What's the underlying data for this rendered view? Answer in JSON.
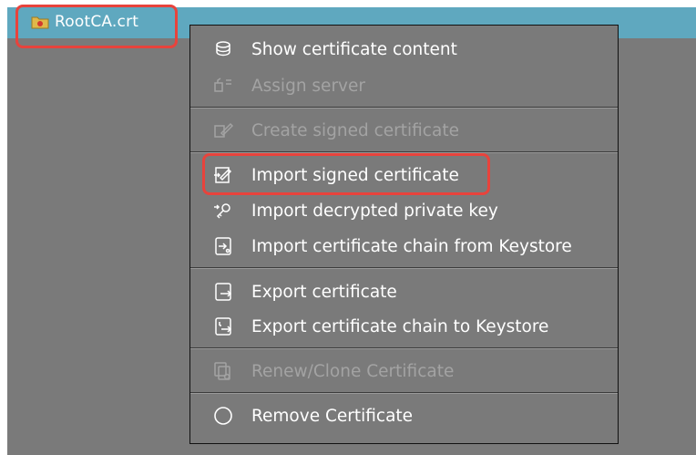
{
  "tree": {
    "node_label": "RootCA.crt",
    "node_icon": "certificate-folder-icon"
  },
  "menu": {
    "items": [
      {
        "label": "Show certificate content",
        "icon": "certificate-content-icon",
        "enabled": true
      },
      {
        "label": "Assign server",
        "icon": "assign-server-icon",
        "enabled": false
      },
      {
        "label": "Create signed certificate",
        "icon": "create-signed-certificate-icon",
        "enabled": false
      },
      {
        "label": "Import signed certificate",
        "icon": "import-signed-certificate-icon",
        "enabled": true
      },
      {
        "label": "Import decrypted private key",
        "icon": "import-private-key-icon",
        "enabled": true
      },
      {
        "label": "Import certificate chain from Keystore",
        "icon": "import-chain-icon",
        "enabled": true
      },
      {
        "label": "Export certificate",
        "icon": "export-certificate-icon",
        "enabled": true
      },
      {
        "label": "Export certificate chain to Keystore",
        "icon": "export-chain-icon",
        "enabled": true
      },
      {
        "label": "Renew/Clone Certificate",
        "icon": "renew-clone-icon",
        "enabled": false
      },
      {
        "label": "Remove Certificate",
        "icon": "remove-circle-icon",
        "enabled": true
      }
    ]
  },
  "colors": {
    "tree_bar": "#5fa8bf",
    "menu_background": "#7a7a7a",
    "highlight": "#e8433c",
    "enabled_text": "#ffffff",
    "disabled_text": "#a3a3a3"
  }
}
